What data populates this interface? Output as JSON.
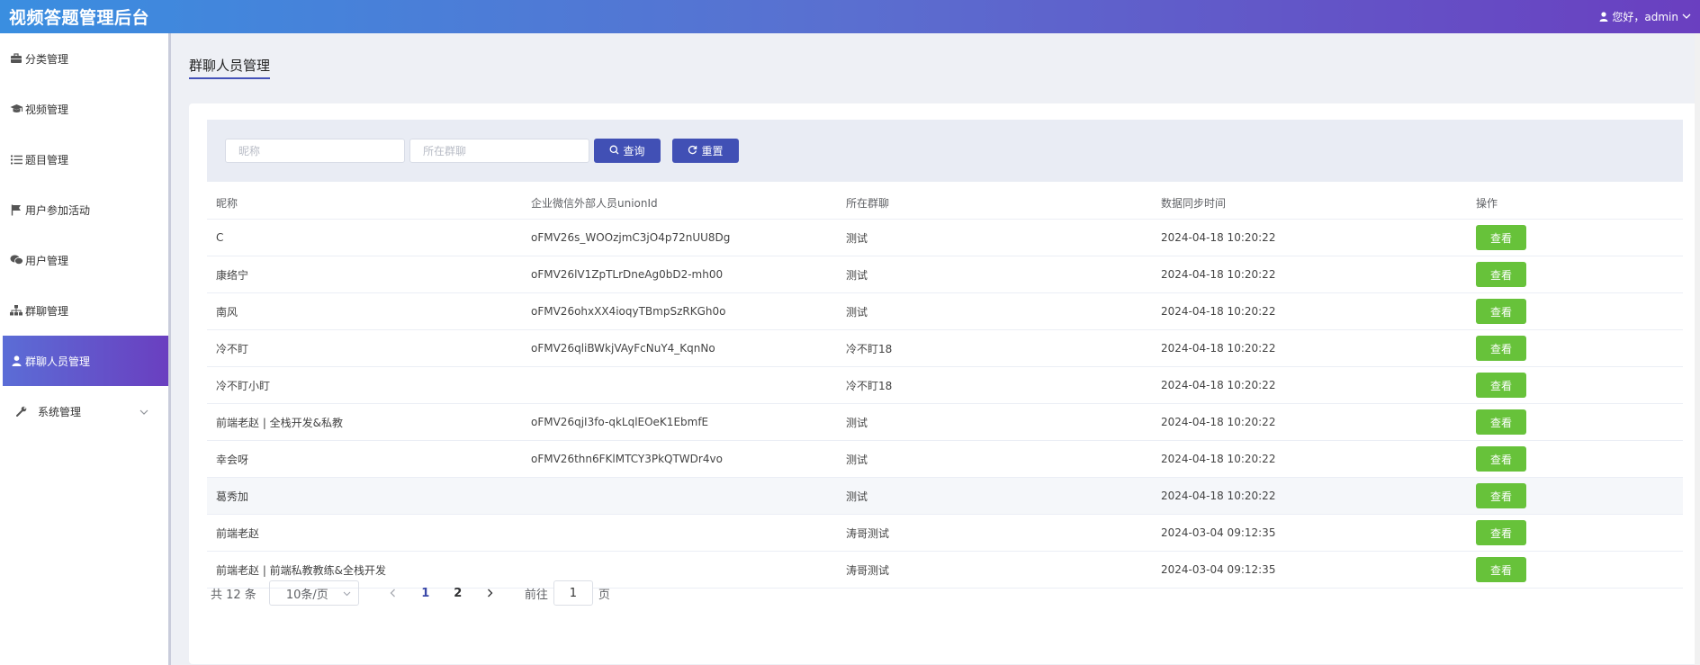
{
  "header": {
    "title": "视频答题管理后台",
    "greeting": "您好，admin"
  },
  "sidebar": {
    "items": [
      {
        "label": "分类管理",
        "icon": "briefcase-icon"
      },
      {
        "label": "视频管理",
        "icon": "graduation-cap-icon"
      },
      {
        "label": "题目管理",
        "icon": "list-icon"
      },
      {
        "label": "用户参加活动",
        "icon": "flag-icon"
      },
      {
        "label": "用户管理",
        "icon": "chat-icon"
      },
      {
        "label": "群聊管理",
        "icon": "sitemap-icon"
      },
      {
        "label": "群聊人员管理",
        "icon": "user-icon",
        "active": true
      },
      {
        "label": "系统管理",
        "icon": "wrench-icon",
        "expandable": true
      }
    ]
  },
  "page": {
    "title": "群聊人员管理"
  },
  "filters": {
    "nickname_placeholder": "昵称",
    "group_placeholder": "所在群聊",
    "search_label": "查询",
    "reset_label": "重置"
  },
  "table": {
    "headers": [
      "昵称",
      "企业微信外部人员unionId",
      "所在群聊",
      "数据同步时间",
      "操作"
    ],
    "rows": [
      {
        "nickname": "C",
        "unionid": "oFMV26s_WOOzjmC3jO4p72nUU8Dg",
        "group": "测试",
        "time": "2024-04-18 10:20:22",
        "action": "查看"
      },
      {
        "nickname": "康络宁",
        "unionid": "oFMV26lV1ZpTLrDneAg0bD2-mh00",
        "group": "测试",
        "time": "2024-04-18 10:20:22",
        "action": "查看"
      },
      {
        "nickname": "南风",
        "unionid": "oFMV26ohxXX4ioqyTBmpSzRKGh0o",
        "group": "测试",
        "time": "2024-04-18 10:20:22",
        "action": "查看"
      },
      {
        "nickname": "冷不盯",
        "unionid": "oFMV26qliBWkjVAyFcNuY4_KqnNo",
        "group": "冷不盯18",
        "time": "2024-04-18 10:20:22",
        "action": "查看"
      },
      {
        "nickname": "冷不盯小盯",
        "unionid": "",
        "group": "冷不盯18",
        "time": "2024-04-18 10:20:22",
        "action": "查看"
      },
      {
        "nickname": "前端老赵 | 全栈开发&私教",
        "unionid": "oFMV26qjI3fo-qkLqlEOeK1EbmfE",
        "group": "测试",
        "time": "2024-04-18 10:20:22",
        "action": "查看"
      },
      {
        "nickname": "幸会呀",
        "unionid": "oFMV26thn6FKlMTCY3PkQTWDr4vo",
        "group": "测试",
        "time": "2024-04-18 10:20:22",
        "action": "查看"
      },
      {
        "nickname": "葛秀加",
        "unionid": "",
        "group": "测试",
        "time": "2024-04-18 10:20:22",
        "action": "查看",
        "hover": true
      },
      {
        "nickname": "前端老赵",
        "unionid": "",
        "group": "涛哥测试",
        "time": "2024-03-04 09:12:35",
        "action": "查看"
      },
      {
        "nickname": "前端老赵 | 前端私教教练&全栈开发",
        "unionid": "",
        "group": "涛哥测试",
        "time": "2024-03-04 09:12:35",
        "action": "查看"
      }
    ]
  },
  "pagination": {
    "total": "共 12 条",
    "page_size": "10条/页",
    "pages": [
      "1",
      "2"
    ],
    "current_page": "1",
    "goto_label": "前往",
    "goto_value": "1",
    "page_unit": "页"
  },
  "colors": {
    "accent": "#4150b5",
    "view_button": "#67c23a"
  }
}
